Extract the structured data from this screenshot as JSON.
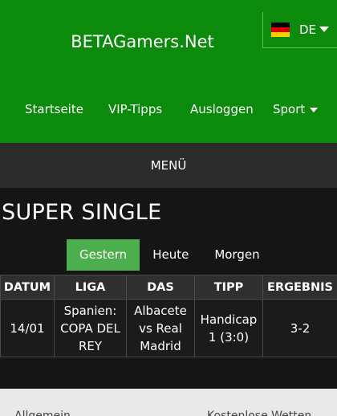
{
  "header": {
    "brand": "BETAGamers.Net",
    "language": {
      "label": "DE",
      "flag_colors": [
        "#000000",
        "#dd0000",
        "#ffce00"
      ]
    },
    "nav": [
      {
        "label": "Startseite"
      },
      {
        "label": "VIP-Tipps"
      },
      {
        "label": "Ausloggen"
      },
      {
        "label": "Sport"
      }
    ]
  },
  "menubar": {
    "label": "MENÜ"
  },
  "main": {
    "title": "SUPER SINGLE",
    "tabs": [
      {
        "label": "Gestern",
        "active": true
      },
      {
        "label": "Heute",
        "active": false
      },
      {
        "label": "Morgen",
        "active": false
      }
    ],
    "table": {
      "columns": [
        "DATUM",
        "LIGA",
        "DAS",
        "TIPP",
        "ERGEBNIS"
      ],
      "rows": [
        {
          "date": "14/01",
          "league": "Spanien: COPA DEL REY",
          "match": "Albacete vs Real Madrid",
          "tip": "Handicap 1 (3:0)",
          "result": "3-2"
        }
      ]
    }
  },
  "footer": {
    "links": [
      {
        "label": "Allgemein"
      },
      {
        "label": "Kostenlose Wetten"
      }
    ]
  },
  "colors": {
    "header_green": "#0b8a0b",
    "active_tab": "#4cae4c",
    "background": "#151515",
    "menubar": "#2b2b2b"
  }
}
